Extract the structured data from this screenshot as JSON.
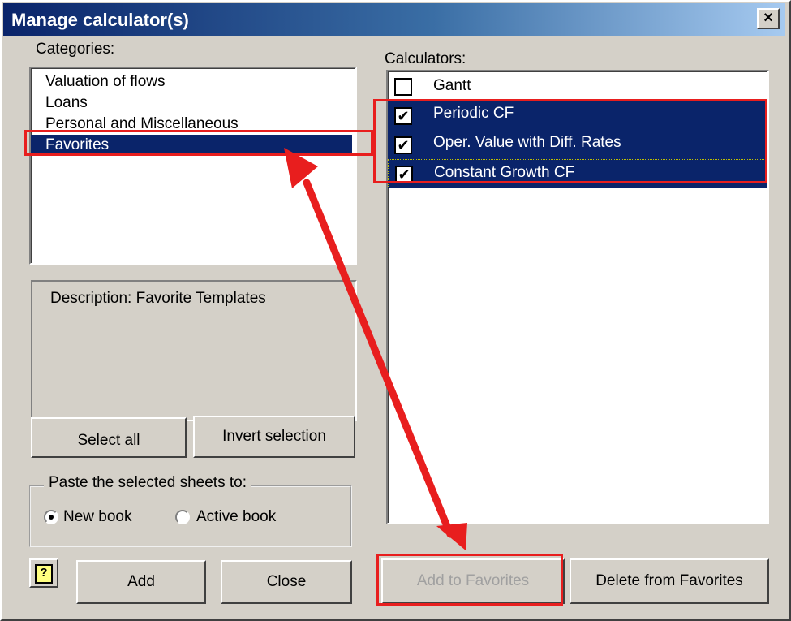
{
  "window": {
    "title": "Manage calculator(s)",
    "close_label": "×"
  },
  "categories": {
    "label": "Categories:",
    "items": [
      {
        "label": "Valuation of flows"
      },
      {
        "label": "Loans"
      },
      {
        "label": "Personal and Miscellaneous"
      },
      {
        "label": "Favorites",
        "selected": true
      }
    ]
  },
  "description": {
    "text": "Description: Favorite Templates"
  },
  "buttons": {
    "select_all": "Select all",
    "invert_selection": "Invert selection",
    "help": "?",
    "add": "Add",
    "close": "Close",
    "add_to_favorites": "Add to Favorites",
    "delete_from_favorites": "Delete from  Favorites"
  },
  "paste": {
    "legend": "Paste the selected sheets to:",
    "options": [
      {
        "label": "New book",
        "checked": true
      },
      {
        "label": "Active book",
        "checked": false
      }
    ]
  },
  "calculators": {
    "label": "Calculators:",
    "items": [
      {
        "label": "Gantt",
        "checked": false,
        "selected": false
      },
      {
        "label": "Periodic CF",
        "checked": true,
        "selected": true
      },
      {
        "label": "Oper. Value with Diff. Rates",
        "checked": true,
        "selected": true
      },
      {
        "label": "Constant Growth CF",
        "checked": true,
        "selected": true
      }
    ]
  },
  "annotation": {
    "color": "#e81e1e"
  },
  "icons": {
    "check": "✔",
    "help": "help-icon"
  }
}
